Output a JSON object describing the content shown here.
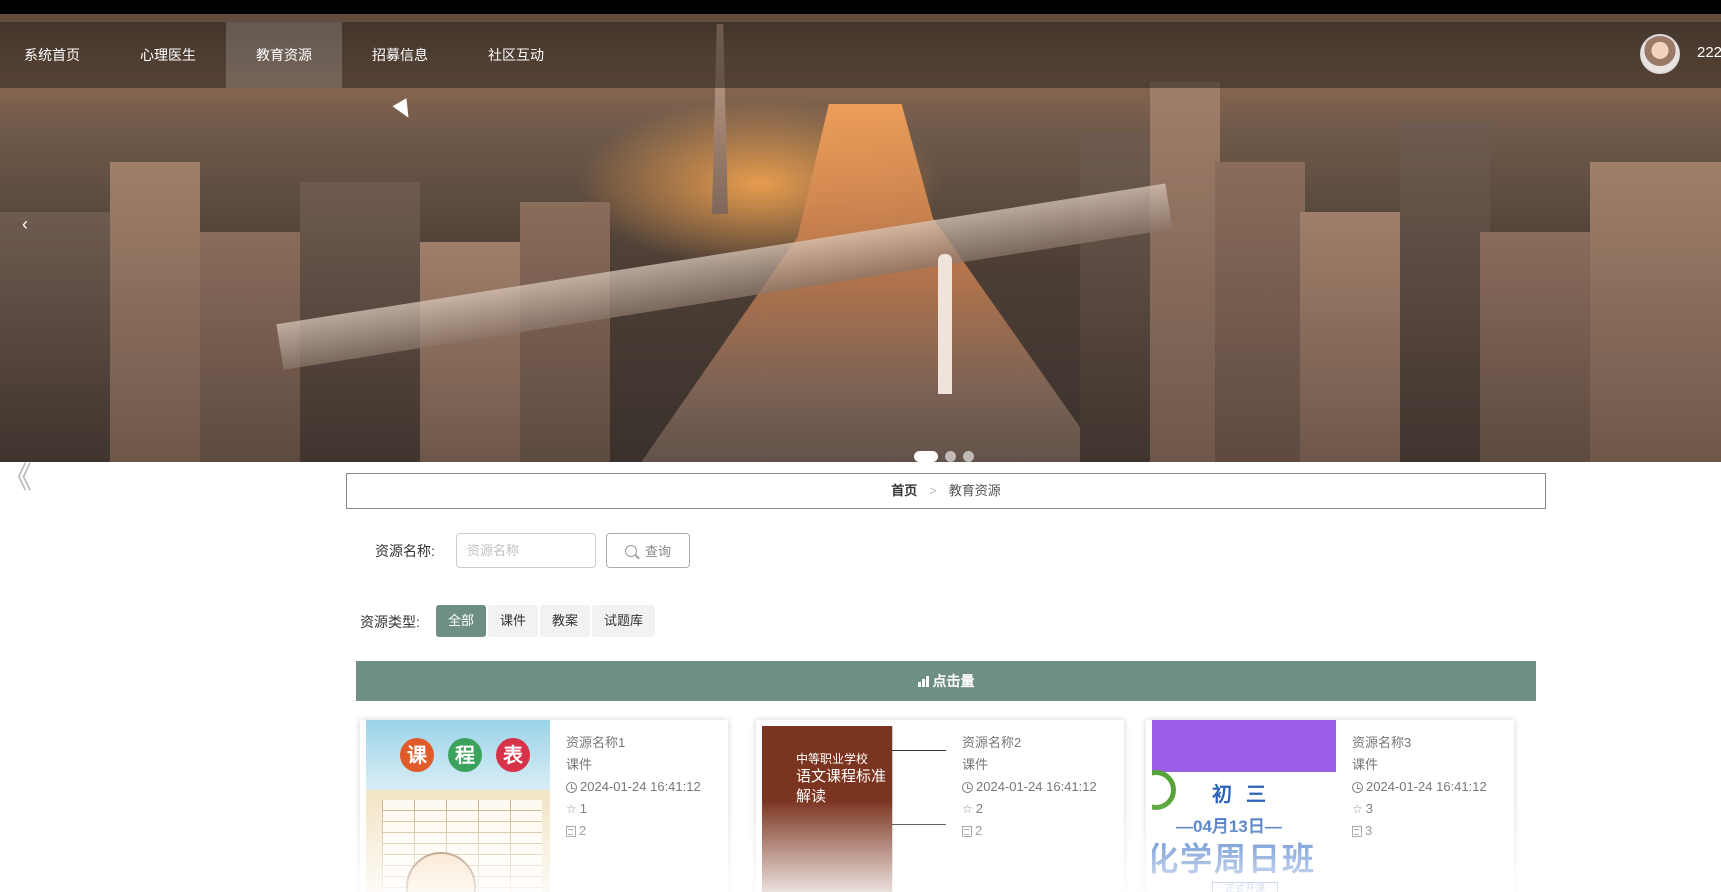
{
  "nav": {
    "items": [
      {
        "label": "系统首页"
      },
      {
        "label": "心理医生"
      },
      {
        "label": "教育资源"
      },
      {
        "label": "招募信息"
      },
      {
        "label": "社区互动"
      }
    ],
    "active_index": 2,
    "username": "222"
  },
  "hero": {
    "prev_icon": "‹",
    "slide_count": 3,
    "active_slide": 1
  },
  "side_back_icon": "《",
  "breadcrumb": {
    "home": "首页",
    "separator": ">",
    "current": "教育资源"
  },
  "search": {
    "label": "资源名称:",
    "placeholder": "资源名称",
    "value": "",
    "button_label": "查询"
  },
  "type_filter": {
    "label": "资源类型:",
    "options": [
      "全部",
      "课件",
      "教案",
      "试题库"
    ],
    "active_index": 0
  },
  "section": {
    "title": "点击量"
  },
  "cards": [
    {
      "name": "资源名称1",
      "type": "课件",
      "time": "2024-01-24 16:41:12",
      "likes": "1",
      "count": "2",
      "thumb_text": {
        "a": "课",
        "b": "程",
        "c": "表"
      }
    },
    {
      "name": "资源名称2",
      "type": "课件",
      "time": "2024-01-24 16:41:12",
      "likes": "2",
      "count": "2",
      "thumb_text": {
        "a": "中等职业学校",
        "b": "语文课程标准",
        "c": "解读"
      }
    },
    {
      "name": "资源名称3",
      "type": "课件",
      "time": "2024-01-24 16:41:12",
      "likes": "3",
      "count": "3",
      "thumb_text": {
        "a": "初三",
        "b": "—04月13日—",
        "c": "化学周日班",
        "d": "正式开课"
      }
    }
  ],
  "colors": {
    "accent": "#6f8f84",
    "nav_overlay": "#28221e"
  }
}
